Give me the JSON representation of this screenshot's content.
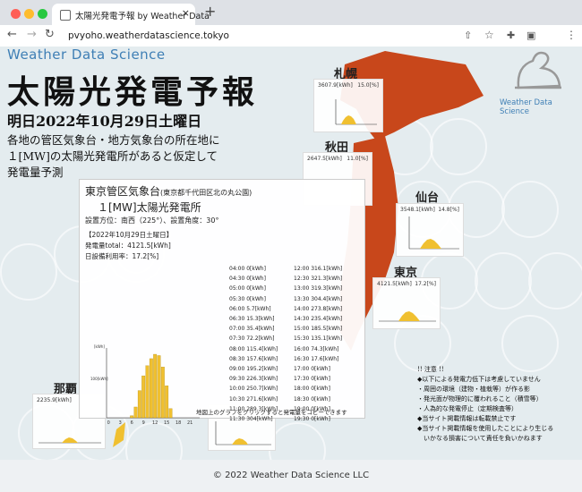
{
  "browser": {
    "tab_title": "太陽光発電予報 by Weather Data",
    "tab_close": "×",
    "new_tab": "+",
    "url": "pvyoho.weatherdatascience.tokyo"
  },
  "header": {
    "brand": "Weather Data Science",
    "title": "太陽光発電予報",
    "date_line": "明日2022年10月29日土曜日",
    "intro": [
      "各地の管区気象台・地方気象台の所在地に",
      "１[MW]の太陽光発電所があると仮定して",
      "発電量予測"
    ],
    "logo_text": "Weather Data Science"
  },
  "cities": {
    "sapporo": {
      "name": "札幌",
      "kwh": "3607.9[kWh]",
      "pct": "15.0[%]"
    },
    "akita": {
      "name": "秋田",
      "kwh": "2647.5[kWh]",
      "pct": "11.0[%]"
    },
    "sendai": {
      "name": "仙台",
      "kwh": "3548.1[kWh]",
      "pct": "14.8[%]"
    },
    "tokyo": {
      "name": "東京",
      "kwh": "4121.5[kWh]",
      "pct": "17.2[%]"
    },
    "naha": {
      "name": "那覇",
      "kwh": "2235.9[kWh]",
      "pct": ""
    }
  },
  "popup": {
    "region": "東京管区気象台",
    "region_sub": "(東京都千代田区北の丸公園)",
    "plant": "１[MW]太陽光発電所",
    "settings": "設置方位：南西（225°）、設置角度：30°",
    "date": "【2022年10月29日土曜日】",
    "total": "発電量total：4121.5[kWh]",
    "rate": "日設備利用率：17.2[%]",
    "hours_left": [
      "04:00 0[kWh]",
      "04:30 0[kWh]",
      "05:00 0[kWh]",
      "05:30 0[kWh]",
      "06:00 5.7[kWh]",
      "06:30 15.3[kWh]",
      "07:00 35.4[kWh]",
      "07:30 72.2[kWh]",
      "08:00 115.4[kWh]",
      "08:30 157.6[kWh]",
      "09:00 195.2[kWh]",
      "09:30 226.3[kWh]",
      "10:00 250.7[kWh]",
      "10:30 271.6[kWh]",
      "11:00 289.3[kWh]",
      "11:30 304[kWh]"
    ],
    "hours_right": [
      "12:00 316.1[kWh]",
      "12:30 321.3[kWh]",
      "13:00 319.3[kWh]",
      "13:30 304.4[kWh]",
      "14:00 273.8[kWh]",
      "14:30 235.4[kWh]",
      "15:00 185.5[kWh]",
      "15:30 135.1[kWh]",
      "16:00 74.3[kWh]",
      "16:30 17.6[kWh]",
      "17:00 0[kWh]",
      "17:30 0[kWh]",
      "18:00 0[kWh]",
      "18:30 0[kWh]",
      "19:00 0[kWh]",
      "19:30 0[kWh]"
    ],
    "footnote": "地図上のグラフをクリックすると発電量をコピーできます",
    "chart_ylabel_top": "[kWh]",
    "chart_ylabel_mid": "100[kWh]"
  },
  "notes": [
    "!! 注意 !!",
    "◆以下による発電力低下は考慮していません",
    "・周囲の環境（建物・植栽等）が作る影",
    "・発光面が物理的に覆われること（積雪等）",
    "・人為的な発電停止（定期検査等）",
    "◆当サイト掲載情報は転載禁止です",
    "◆当サイト掲載情報を使用したことにより生じる",
    "　いかなる損害について責任を負いかねます"
  ],
  "footer": "© 2022 Weather Data Science LLC",
  "chart_data": {
    "type": "bar",
    "categories": [
      "0",
      "1",
      "2",
      "3",
      "4",
      "5",
      "6",
      "7",
      "8",
      "9",
      "10",
      "11",
      "12",
      "13",
      "14",
      "15",
      "16",
      "17",
      "18",
      "19",
      "20",
      "21",
      "22",
      "23"
    ],
    "values": [
      0,
      0,
      0,
      0,
      0,
      0,
      21,
      108,
      273,
      421,
      522,
      593,
      637,
      624,
      509,
      321,
      92,
      0,
      0,
      0,
      0,
      0,
      0,
      0
    ],
    "xticks": [
      "0",
      "3",
      "6",
      "9",
      "12",
      "15",
      "18",
      "21"
    ],
    "ylim": [
      0,
      700
    ]
  },
  "colors": {
    "map": "#c8471b",
    "bars": "#f0c030",
    "brand": "#3f7fb5"
  }
}
